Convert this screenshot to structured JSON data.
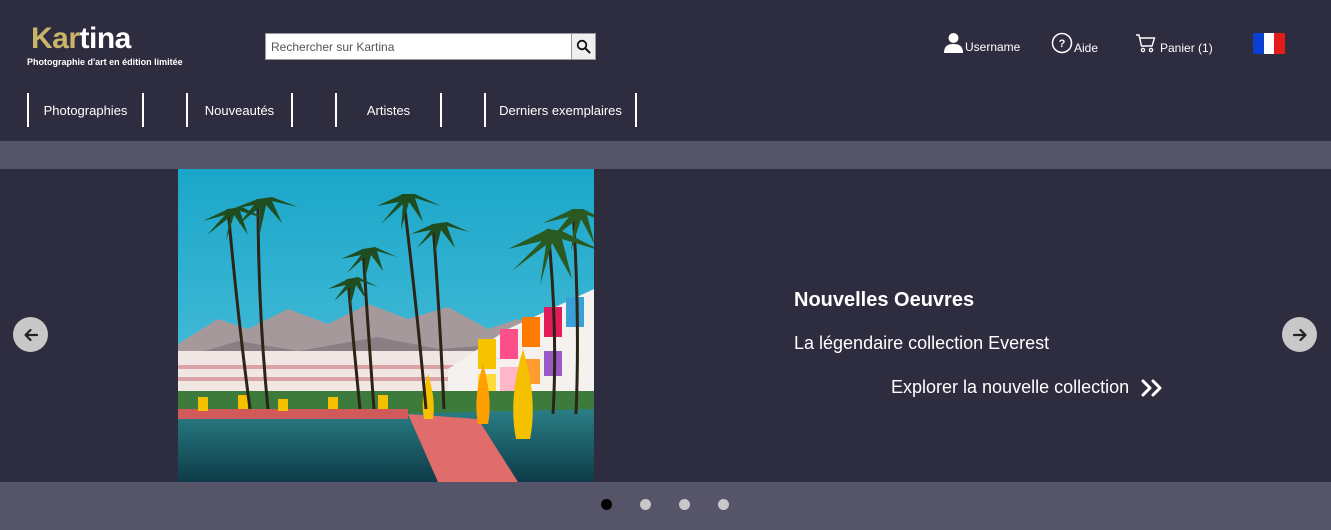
{
  "brand": {
    "logo_part1": "Kar",
    "logo_part2": "tina",
    "tagline": "Photographie d'art en édition limitée",
    "gold": "#c9b46a"
  },
  "search": {
    "placeholder": "Rechercher sur Kartina",
    "value": "",
    "icon": "search-icon"
  },
  "utilities": {
    "user_label": "Username",
    "help_label": "Aide",
    "cart_label": "Panier (1)",
    "language_flag": "flag-fr-icon"
  },
  "nav": {
    "items": [
      {
        "label": "Photographies"
      },
      {
        "label": "Nouveautés"
      },
      {
        "label": "Artistes"
      },
      {
        "label": "Derniers exemplaires"
      }
    ]
  },
  "hero": {
    "title": "Nouvelles Oeuvres",
    "subtitle": "La légendaire collection Everest",
    "cta": "Explorer la nouvelle collection",
    "prev_icon": "arrow-left-icon",
    "next_icon": "arrow-right-icon",
    "slides": 4,
    "active_slide": 1
  },
  "colors": {
    "background": "#2e2c3f",
    "band": "#565469",
    "control": "#c8c8c8"
  }
}
